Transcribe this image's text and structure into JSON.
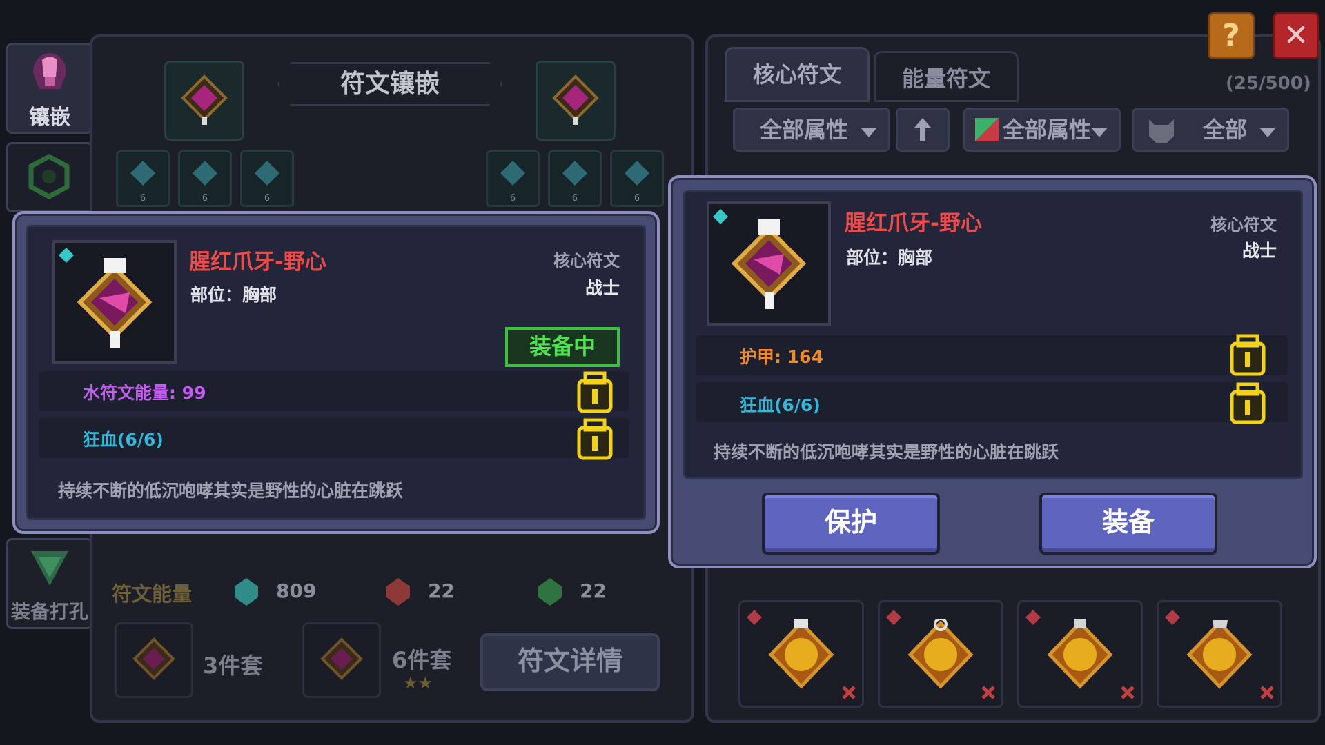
{
  "sidebar": {
    "items": [
      {
        "label": "镶嵌"
      },
      {
        "label": ""
      },
      {
        "label": "装备打孔"
      }
    ]
  },
  "rune_inlay": {
    "title": "符文镶嵌",
    "small_slot_level": "6",
    "energy_label": "符文能量",
    "energy": [
      {
        "value": "809",
        "color": "#3fbfb4"
      },
      {
        "value": "22",
        "color": "#c94b4b"
      },
      {
        "value": "22",
        "color": "#3f9a52"
      }
    ],
    "sets": [
      {
        "label": "3件套"
      },
      {
        "label": "6件套",
        "stars": "★★"
      }
    ],
    "details_button": "符文详情"
  },
  "inventory": {
    "tabs": [
      "核心符文",
      "能量符文"
    ],
    "count": "(25/500)",
    "filters": [
      "全部属性",
      "全部属性",
      "全部"
    ],
    "sort_icon": "up-arrow-icon"
  },
  "equipped_popup": {
    "name": "腥红爪牙-野心",
    "slot": "部位：胸部",
    "type": "核心符文",
    "class": "战士",
    "badge": "装备中",
    "stats": [
      {
        "label": "水符文能量: 99",
        "color": "#c45cf2"
      },
      {
        "label": "狂血(6/6)",
        "color": "#34b7d8"
      }
    ],
    "description": "持续不断的低沉咆哮其实是野性的心脏在跳跃"
  },
  "compare_popup": {
    "name": "腥红爪牙-野心",
    "slot": "部位：胸部",
    "type": "核心符文",
    "class": "战士",
    "stats": [
      {
        "label": "护甲: 164",
        "color": "#f08a2a"
      },
      {
        "label": "狂血(6/6)",
        "color": "#34b7d8"
      }
    ],
    "description": "持续不断的低沉咆哮其实是野性的心脏在跳跃",
    "protect_button": "保护",
    "equip_button": "装备"
  },
  "controls": {
    "help": "?",
    "close": "✕"
  },
  "colors": {
    "accent": "#5f64bf",
    "item_name": "#ef4a4a",
    "equipped_green": "#4fe24f",
    "lock_yellow": "#f2d21a"
  }
}
